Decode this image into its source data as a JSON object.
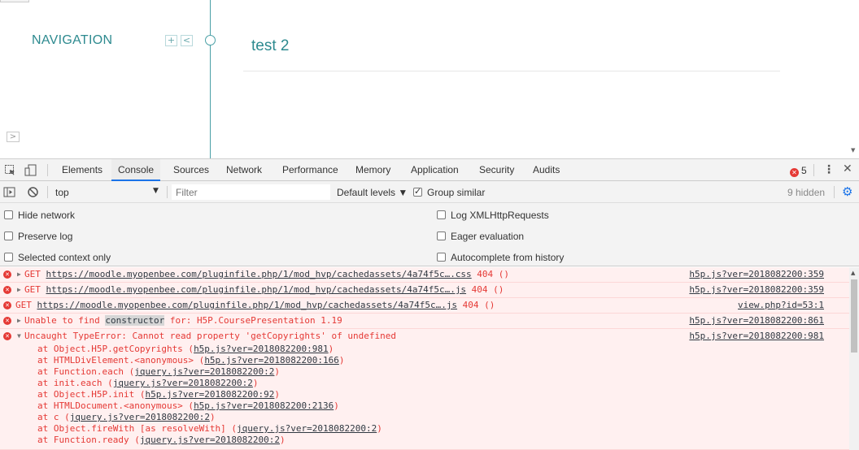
{
  "page": {
    "nav_title": "NAVIGATION",
    "nav_add_glyph": "+",
    "nav_collapse_glyph": "<",
    "heading": "test 2",
    "expand_glyph": ">"
  },
  "devtools": {
    "tabs": [
      {
        "label": "Elements"
      },
      {
        "label": "Console"
      },
      {
        "label": "Sources"
      },
      {
        "label": "Network"
      },
      {
        "label": "Performance"
      },
      {
        "label": "Memory"
      },
      {
        "label": "Application"
      },
      {
        "label": "Security"
      },
      {
        "label": "Audits"
      }
    ],
    "active_tab": "Console",
    "error_count": "5",
    "toolbar": {
      "context": "top",
      "filter_placeholder": "Filter",
      "levels": "Default levels ▼",
      "group_similar": "Group similar",
      "hidden": "9 hidden"
    },
    "settings": {
      "hide_network": "Hide network",
      "preserve_log": "Preserve log",
      "selected_context_only": "Selected context only",
      "log_xhr": "Log XMLHttpRequests",
      "eager_evaluation": "Eager evaluation",
      "autocomplete_history": "Autocomplete from history"
    },
    "messages": [
      {
        "prefix": "GET ",
        "url": "https://moodle.myopenbee.com/pluginfile.php/1/mod_hvp/cachedassets/4a74f5c….css",
        "suffix": " 404 ()",
        "source": "h5p.js?ver=2018082200:359"
      },
      {
        "prefix": "GET ",
        "url": "https://moodle.myopenbee.com/pluginfile.php/1/mod_hvp/cachedassets/4a74f5c….js",
        "suffix": " 404 ()",
        "source": "h5p.js?ver=2018082200:359"
      },
      {
        "prefix": "GET ",
        "url": "https://moodle.myopenbee.com/pluginfile.php/1/mod_hvp/cachedassets/4a74f5c….js",
        "suffix": " 404 ()",
        "source": "view.php?id=53:1"
      },
      {
        "before": "Unable to find ",
        "highlight": "constructor",
        "after": " for: H5P.CoursePresentation 1.19",
        "source": "h5p.js?ver=2018082200:861"
      },
      {
        "text": "Uncaught TypeError: Cannot read property 'getCopyrights' of undefined",
        "source": "h5p.js?ver=2018082200:981"
      }
    ],
    "stack": [
      {
        "at": "at Object.H5P.getCopyrights (",
        "link": "h5p.js?ver=2018082200:981",
        "end": ")"
      },
      {
        "at": "at HTMLDivElement.<anonymous> (",
        "link": "h5p.js?ver=2018082200:166",
        "end": ")"
      },
      {
        "at": "at Function.each (",
        "link": "jquery.js?ver=2018082200:2",
        "end": ")"
      },
      {
        "at": "at init.each (",
        "link": "jquery.js?ver=2018082200:2",
        "end": ")"
      },
      {
        "at": "at Object.H5P.init (",
        "link": "h5p.js?ver=2018082200:92",
        "end": ")"
      },
      {
        "at": "at HTMLDocument.<anonymous> (",
        "link": "h5p.js?ver=2018082200:2136",
        "end": ")"
      },
      {
        "at": "at c (",
        "link": "jquery.js?ver=2018082200:2",
        "end": ")"
      },
      {
        "at": "at Object.fireWith [as resolveWith] (",
        "link": "jquery.js?ver=2018082200:2",
        "end": ")"
      },
      {
        "at": "at Function.ready (",
        "link": "jquery.js?ver=2018082200:2",
        "end": ")"
      }
    ]
  }
}
